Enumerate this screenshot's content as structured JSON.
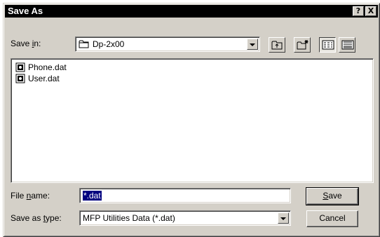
{
  "window": {
    "title": "Save As",
    "help_label": "?",
    "close_label": "X"
  },
  "save_in": {
    "label_prefix": "Save ",
    "label_access": "i",
    "label_suffix": "n:",
    "value": "Dp-2x00"
  },
  "files": [
    {
      "name": "Phone.dat",
      "icon": "data-file-icon"
    },
    {
      "name": "User.dat",
      "icon": "data-file-icon"
    }
  ],
  "file_name": {
    "label_prefix": "File ",
    "label_access": "n",
    "label_suffix": "ame:",
    "value": "*.dat"
  },
  "save_as_type": {
    "label_prefix": "Save as ",
    "label_access": "t",
    "label_suffix": "ype:",
    "value": "MFP Utilities Data (*.dat)"
  },
  "buttons": {
    "save_access": "S",
    "save_rest": "ave",
    "cancel": "Cancel"
  },
  "colors": {
    "face": "#d4d0c8",
    "titlebar": "#000000",
    "selection": "#000080"
  }
}
